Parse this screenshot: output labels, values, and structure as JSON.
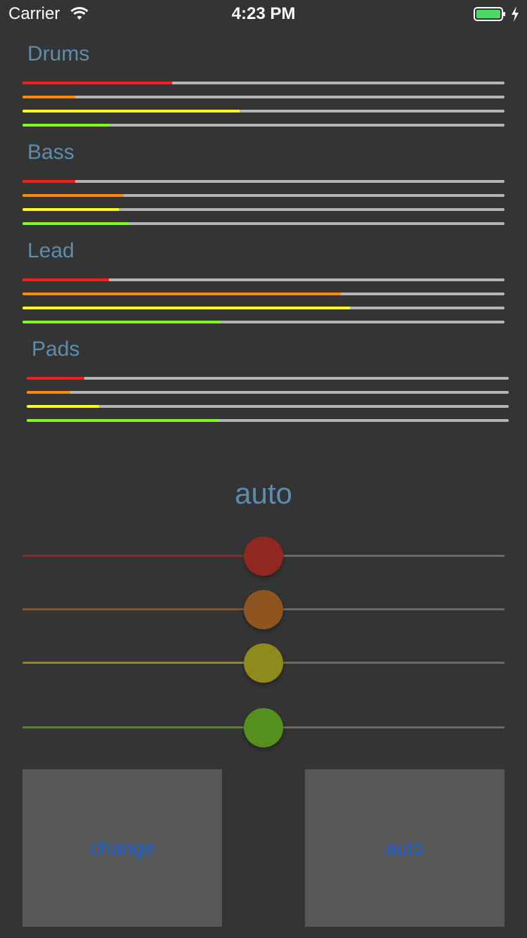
{
  "status_bar": {
    "carrier": "Carrier",
    "time": "4:23 PM",
    "icons": [
      "wifi-icon",
      "battery-icon",
      "charging-bolt-icon"
    ],
    "battery_color": "#4cd964"
  },
  "colors": {
    "red": "#ff1a1a",
    "orange": "#ff8a00",
    "yellow": "#ffff1a",
    "green": "#7cff1a",
    "title": "#5b8db0",
    "button_text": "#1d5fd1"
  },
  "sections": [
    {
      "title": "Drums",
      "levels": [
        0.31,
        0.11,
        0.45,
        0.18
      ]
    },
    {
      "title": "Bass",
      "levels": [
        0.11,
        0.21,
        0.2,
        0.22
      ]
    },
    {
      "title": "Lead",
      "levels": [
        0.18,
        0.66,
        0.68,
        0.41
      ]
    },
    {
      "title": "Pads",
      "levels": [
        0.12,
        0.09,
        0.15,
        0.4
      ]
    }
  ],
  "mode_label": "auto",
  "sliders": [
    {
      "name": "red",
      "value": 0.5,
      "track_color": "#8a2a22",
      "thumb_color": "#8f2820"
    },
    {
      "name": "orange",
      "value": 0.5,
      "track_color": "#8f5220",
      "thumb_color": "#8f5520"
    },
    {
      "name": "yellow",
      "value": 0.5,
      "track_color": "#8f8a1c",
      "thumb_color": "#8f8a1c"
    },
    {
      "name": "green",
      "value": 0.5,
      "track_color": "#55881c",
      "thumb_color": "#55901c"
    }
  ],
  "buttons": {
    "change": "change",
    "auto": "auto"
  }
}
